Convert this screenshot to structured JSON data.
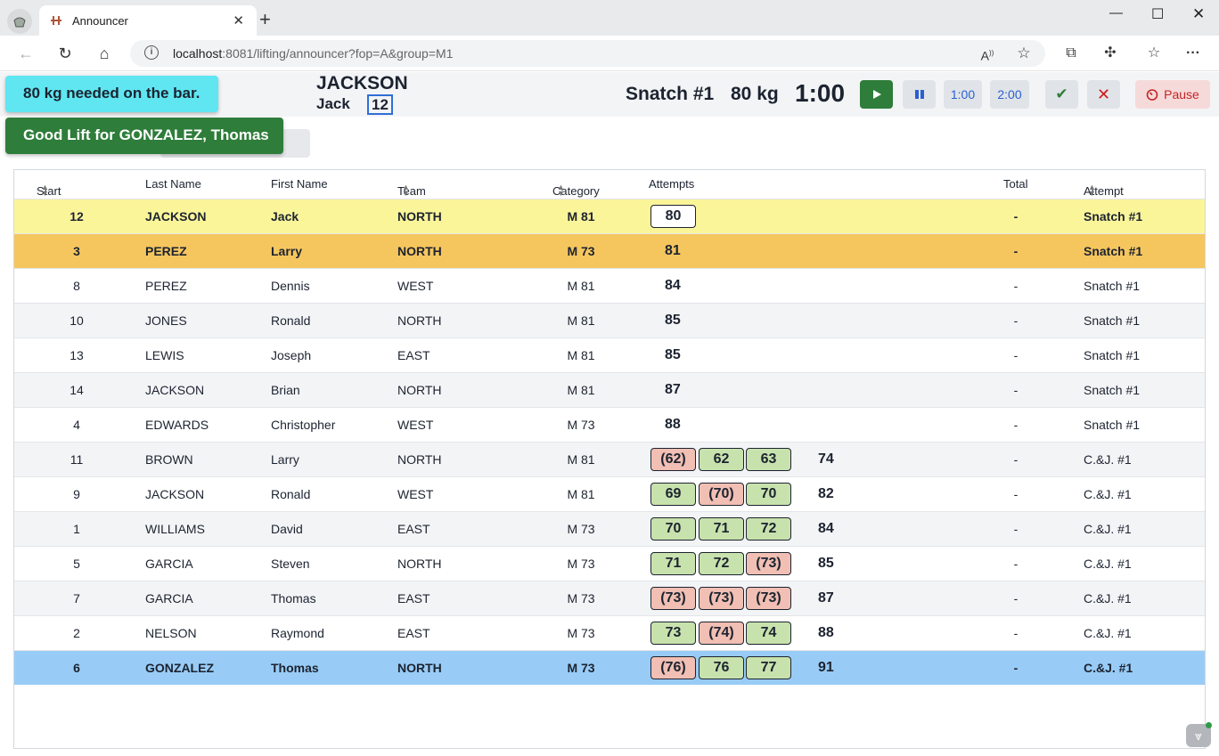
{
  "browser": {
    "tab_title": "Announcer",
    "url_host": "localhost",
    "url_rest": ":8081/lifting/announcer?fop=A&group=M1"
  },
  "current": {
    "last_name": "JACKSON",
    "first_name": "Jack",
    "start_number": "12",
    "lift": "Snatch #1",
    "weight": "80 kg",
    "clock": "1:00"
  },
  "controls": {
    "one_min": "1:00",
    "two_min": "2:00",
    "pause_label": "Pause"
  },
  "notifications": {
    "bar": "80 kg needed on the bar.",
    "decision": "Good Lift for GONZALEZ, Thomas"
  },
  "grid": {
    "headers": {
      "start": "Start Number",
      "last": "Last Name",
      "first": "First Name",
      "team": "Team",
      "category": "Category",
      "attempts": "Attempts",
      "total": "Total",
      "attempt": "Attempt"
    },
    "rows": [
      {
        "start": "12",
        "last": "JACKSON",
        "first": "Jack",
        "team": "NORTH",
        "cat": "M 81",
        "attempts": [
          {
            "v": "80",
            "s": "req"
          }
        ],
        "best": "",
        "total": "-",
        "attempt": "Snatch #1"
      },
      {
        "start": "3",
        "last": "PEREZ",
        "first": "Larry",
        "team": "NORTH",
        "cat": "M 73",
        "attempts": [
          {
            "v": "81",
            "s": "plain"
          }
        ],
        "best": "",
        "total": "-",
        "attempt": "Snatch #1"
      },
      {
        "start": "8",
        "last": "PEREZ",
        "first": "Dennis",
        "team": "WEST",
        "cat": "M 81",
        "attempts": [
          {
            "v": "84",
            "s": "plain"
          }
        ],
        "best": "",
        "total": "-",
        "attempt": "Snatch #1"
      },
      {
        "start": "10",
        "last": "JONES",
        "first": "Ronald",
        "team": "NORTH",
        "cat": "M 81",
        "attempts": [
          {
            "v": "85",
            "s": "plain"
          }
        ],
        "best": "",
        "total": "-",
        "attempt": "Snatch #1"
      },
      {
        "start": "13",
        "last": "LEWIS",
        "first": "Joseph",
        "team": "EAST",
        "cat": "M 81",
        "attempts": [
          {
            "v": "85",
            "s": "plain"
          }
        ],
        "best": "",
        "total": "-",
        "attempt": "Snatch #1"
      },
      {
        "start": "14",
        "last": "JACKSON",
        "first": "Brian",
        "team": "NORTH",
        "cat": "M 81",
        "attempts": [
          {
            "v": "87",
            "s": "plain"
          }
        ],
        "best": "",
        "total": "-",
        "attempt": "Snatch #1"
      },
      {
        "start": "4",
        "last": "EDWARDS",
        "first": "Christopher",
        "team": "WEST",
        "cat": "M 73",
        "attempts": [
          {
            "v": "88",
            "s": "plain"
          }
        ],
        "best": "",
        "total": "-",
        "attempt": "Snatch #1"
      },
      {
        "start": "11",
        "last": "BROWN",
        "first": "Larry",
        "team": "NORTH",
        "cat": "M 81",
        "attempts": [
          {
            "v": "(62)",
            "s": "bad"
          },
          {
            "v": "62",
            "s": "good"
          },
          {
            "v": "63",
            "s": "good"
          }
        ],
        "best": "74",
        "total": "-",
        "attempt": "C.&J. #1"
      },
      {
        "start": "9",
        "last": "JACKSON",
        "first": "Ronald",
        "team": "WEST",
        "cat": "M 81",
        "attempts": [
          {
            "v": "69",
            "s": "good"
          },
          {
            "v": "(70)",
            "s": "bad"
          },
          {
            "v": "70",
            "s": "good"
          }
        ],
        "best": "82",
        "total": "-",
        "attempt": "C.&J. #1"
      },
      {
        "start": "1",
        "last": "WILLIAMS",
        "first": "David",
        "team": "EAST",
        "cat": "M 73",
        "attempts": [
          {
            "v": "70",
            "s": "good"
          },
          {
            "v": "71",
            "s": "good"
          },
          {
            "v": "72",
            "s": "good"
          }
        ],
        "best": "84",
        "total": "-",
        "attempt": "C.&J. #1"
      },
      {
        "start": "5",
        "last": "GARCIA",
        "first": "Steven",
        "team": "NORTH",
        "cat": "M 73",
        "attempts": [
          {
            "v": "71",
            "s": "good"
          },
          {
            "v": "72",
            "s": "good"
          },
          {
            "v": "(73)",
            "s": "bad"
          }
        ],
        "best": "85",
        "total": "-",
        "attempt": "C.&J. #1"
      },
      {
        "start": "7",
        "last": "GARCIA",
        "first": "Thomas",
        "team": "EAST",
        "cat": "M 73",
        "attempts": [
          {
            "v": "(73)",
            "s": "bad"
          },
          {
            "v": "(73)",
            "s": "bad"
          },
          {
            "v": "(73)",
            "s": "bad"
          }
        ],
        "best": "87",
        "total": "-",
        "attempt": "C.&J. #1"
      },
      {
        "start": "2",
        "last": "NELSON",
        "first": "Raymond",
        "team": "EAST",
        "cat": "M 73",
        "attempts": [
          {
            "v": "73",
            "s": "good"
          },
          {
            "v": "(74)",
            "s": "bad"
          },
          {
            "v": "74",
            "s": "good"
          }
        ],
        "best": "88",
        "total": "-",
        "attempt": "C.&J. #1"
      },
      {
        "start": "6",
        "last": "GONZALEZ",
        "first": "Thomas",
        "team": "NORTH",
        "cat": "M 73",
        "attempts": [
          {
            "v": "(76)",
            "s": "bad"
          },
          {
            "v": "76",
            "s": "good"
          },
          {
            "v": "77",
            "s": "good"
          }
        ],
        "best": "91",
        "total": "-",
        "attempt": "C.&J. #1"
      }
    ]
  },
  "colors": {
    "current_row": "#fbf59a",
    "next_row": "#f6c65e",
    "previous_row": "#98ccf6",
    "good_lift": "#c8e2ad",
    "bad_lift": "#f1bfb3"
  }
}
